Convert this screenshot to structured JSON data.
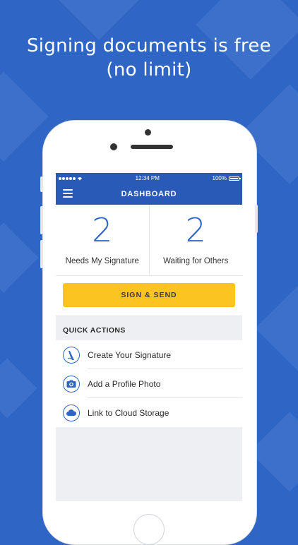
{
  "headline": {
    "line1": "Signing documents is free",
    "line2": "(no limit)"
  },
  "statusbar": {
    "time": "12:34 PM",
    "battery": "100%"
  },
  "navbar": {
    "title": "DASHBOARD"
  },
  "counts": [
    {
      "value": "2",
      "label": "Needs My Signature"
    },
    {
      "value": "2",
      "label": "Waiting for Others"
    }
  ],
  "sign_send": {
    "label": "SIGN & SEND"
  },
  "quick_actions": {
    "header": "QUICK ACTIONS",
    "items": [
      {
        "label": "Create Your Signature",
        "icon": "signature-pen-icon"
      },
      {
        "label": "Add a Profile Photo",
        "icon": "camera-icon"
      },
      {
        "label": "Link to Cloud Storage",
        "icon": "cloud-icon"
      }
    ]
  },
  "colors": {
    "background": "#2f66c6",
    "navbar": "#2a5ab7",
    "accent": "#2f66c6",
    "button": "#fbc421"
  }
}
